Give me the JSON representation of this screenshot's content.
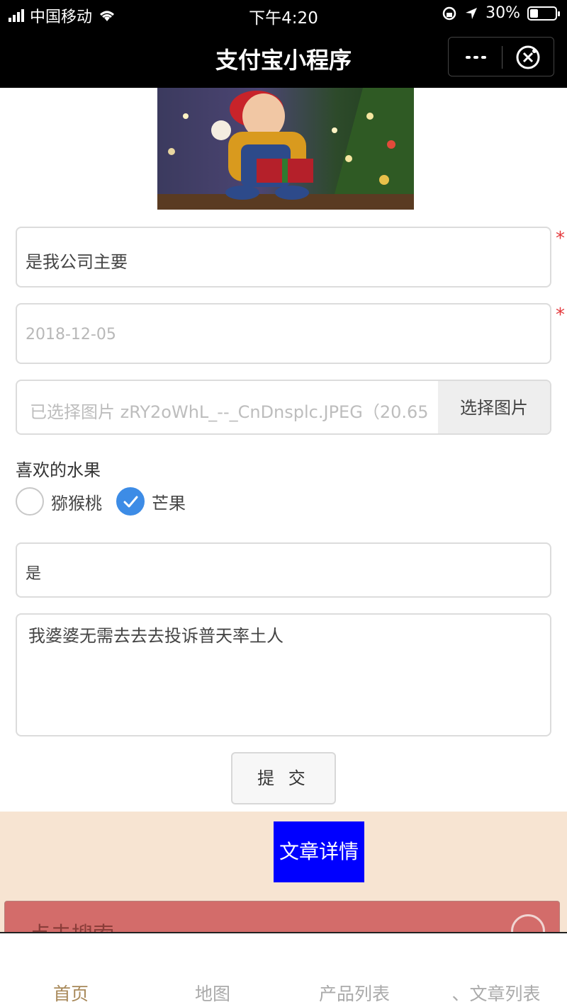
{
  "status_bar": {
    "carrier": "中国移动",
    "time": "下午4:20",
    "battery": "30%",
    "battery_level": 0.3
  },
  "nav": {
    "title": "支付宝小程序",
    "icons": [
      "more-icon",
      "close-icon"
    ]
  },
  "form": {
    "name_value": "是我公司主要",
    "date_placeholder": "2018-12-05",
    "required_mark": "*",
    "file_name": "已选择图片 zRY2oWhL_--_CnDnsplc.JPEG（20.65",
    "file_button": "选择图片",
    "fruit_label": "喜欢的水果",
    "fruits": [
      {
        "label": "猕猴桃",
        "checked": false
      },
      {
        "label": "芒果",
        "checked": true
      }
    ],
    "short_text": "是",
    "textarea_value": "我婆婆无需去去去投诉普天率土人",
    "submit_label": "提 交"
  },
  "article_button": "文章详情",
  "search_text": "点击搜索",
  "tabs": [
    {
      "label": "首页",
      "active": true
    },
    {
      "label": "地图",
      "active": false
    },
    {
      "label": "产品列表",
      "active": false
    },
    {
      "label": "、文章列表",
      "active": false
    }
  ],
  "colors": {
    "accent": "#3d8ce6",
    "tab_active": "#a8895a",
    "required": "#e4393c",
    "article_button": "#0000ff",
    "beige": "#f7e4d2",
    "search_strip": "#d36c6a"
  }
}
